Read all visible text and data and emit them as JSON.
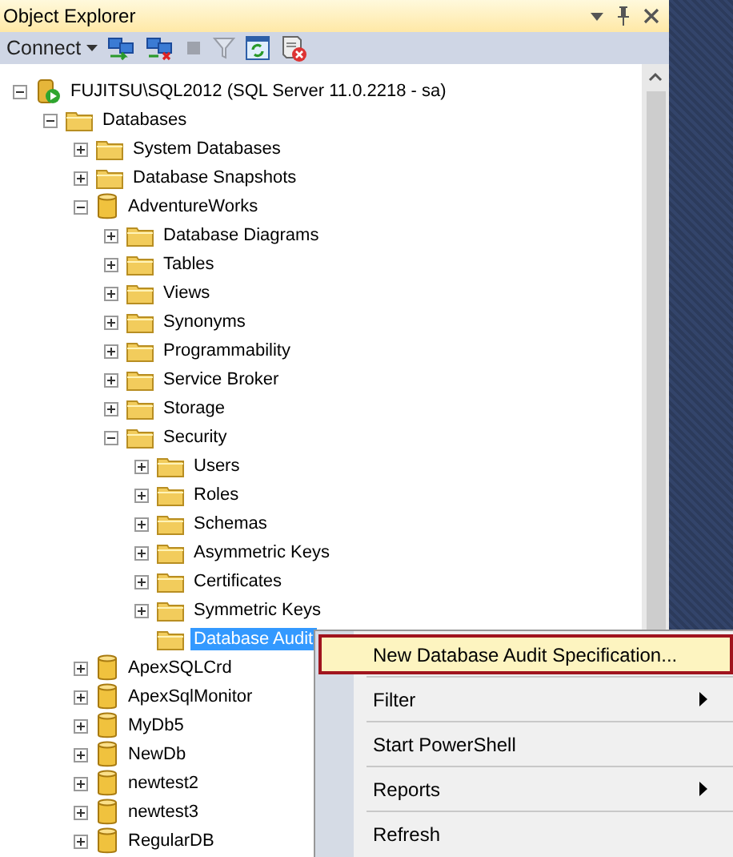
{
  "panel": {
    "title": "Object Explorer"
  },
  "toolbar": {
    "connect_label": "Connect",
    "buttons": [
      {
        "kind": "connect",
        "disabled": false
      },
      {
        "kind": "disconnect",
        "disabled": false
      },
      {
        "kind": "stop",
        "disabled": true
      },
      {
        "kind": "filter",
        "disabled": true
      },
      {
        "kind": "refresh",
        "disabled": false
      },
      {
        "kind": "script",
        "disabled": false
      }
    ]
  },
  "tree": [
    {
      "label": "FUJITSU\\SQL2012 (SQL Server 11.0.2218 - sa)",
      "kind": "server",
      "expandable": true,
      "expanded": true,
      "selected": false,
      "children": [
        {
          "label": "Databases",
          "kind": "folder",
          "expandable": true,
          "expanded": true,
          "selected": false,
          "children": [
            {
              "label": "System Databases",
              "kind": "folder",
              "expandable": true,
              "expanded": false,
              "selected": false
            },
            {
              "label": "Database Snapshots",
              "kind": "folder",
              "expandable": true,
              "expanded": false,
              "selected": false
            },
            {
              "label": "AdventureWorks",
              "kind": "database",
              "expandable": true,
              "expanded": true,
              "selected": false,
              "children": [
                {
                  "label": "Database Diagrams",
                  "kind": "folder",
                  "expandable": true,
                  "expanded": false,
                  "selected": false
                },
                {
                  "label": "Tables",
                  "kind": "folder",
                  "expandable": true,
                  "expanded": false,
                  "selected": false
                },
                {
                  "label": "Views",
                  "kind": "folder",
                  "expandable": true,
                  "expanded": false,
                  "selected": false
                },
                {
                  "label": "Synonyms",
                  "kind": "folder",
                  "expandable": true,
                  "expanded": false,
                  "selected": false
                },
                {
                  "label": "Programmability",
                  "kind": "folder",
                  "expandable": true,
                  "expanded": false,
                  "selected": false
                },
                {
                  "label": "Service Broker",
                  "kind": "folder",
                  "expandable": true,
                  "expanded": false,
                  "selected": false
                },
                {
                  "label": "Storage",
                  "kind": "folder",
                  "expandable": true,
                  "expanded": false,
                  "selected": false
                },
                {
                  "label": "Security",
                  "kind": "folder",
                  "expandable": true,
                  "expanded": true,
                  "selected": false,
                  "children": [
                    {
                      "label": "Users",
                      "kind": "folder",
                      "expandable": true,
                      "expanded": false,
                      "selected": false
                    },
                    {
                      "label": "Roles",
                      "kind": "folder",
                      "expandable": true,
                      "expanded": false,
                      "selected": false
                    },
                    {
                      "label": "Schemas",
                      "kind": "folder",
                      "expandable": true,
                      "expanded": false,
                      "selected": false
                    },
                    {
                      "label": "Asymmetric Keys",
                      "kind": "folder",
                      "expandable": true,
                      "expanded": false,
                      "selected": false
                    },
                    {
                      "label": "Certificates",
                      "kind": "folder",
                      "expandable": true,
                      "expanded": false,
                      "selected": false
                    },
                    {
                      "label": "Symmetric Keys",
                      "kind": "folder",
                      "expandable": true,
                      "expanded": false,
                      "selected": false
                    },
                    {
                      "label": "Database Audit",
                      "kind": "folder",
                      "expandable": false,
                      "expanded": false,
                      "selected": true
                    }
                  ]
                }
              ]
            },
            {
              "label": "ApexSQLCrd",
              "kind": "database",
              "expandable": true,
              "expanded": false,
              "selected": false
            },
            {
              "label": "ApexSqlMonitor",
              "kind": "database",
              "expandable": true,
              "expanded": false,
              "selected": false
            },
            {
              "label": "MyDb5",
              "kind": "database",
              "expandable": true,
              "expanded": false,
              "selected": false
            },
            {
              "label": "NewDb",
              "kind": "database",
              "expandable": true,
              "expanded": false,
              "selected": false
            },
            {
              "label": "newtest2",
              "kind": "database",
              "expandable": true,
              "expanded": false,
              "selected": false
            },
            {
              "label": "newtest3",
              "kind": "database",
              "expandable": true,
              "expanded": false,
              "selected": false
            },
            {
              "label": "RegularDB",
              "kind": "database",
              "expandable": true,
              "expanded": false,
              "selected": false
            }
          ]
        }
      ]
    }
  ],
  "context_menu": {
    "items": [
      {
        "label": "New Database Audit Specification...",
        "submenu": false,
        "selected": true
      },
      {
        "label": "Filter",
        "submenu": true,
        "selected": false
      },
      {
        "label": "Start PowerShell",
        "submenu": false,
        "selected": false
      },
      {
        "label": "Reports",
        "submenu": true,
        "selected": false
      },
      {
        "label": "Refresh",
        "submenu": false,
        "selected": false
      }
    ]
  }
}
